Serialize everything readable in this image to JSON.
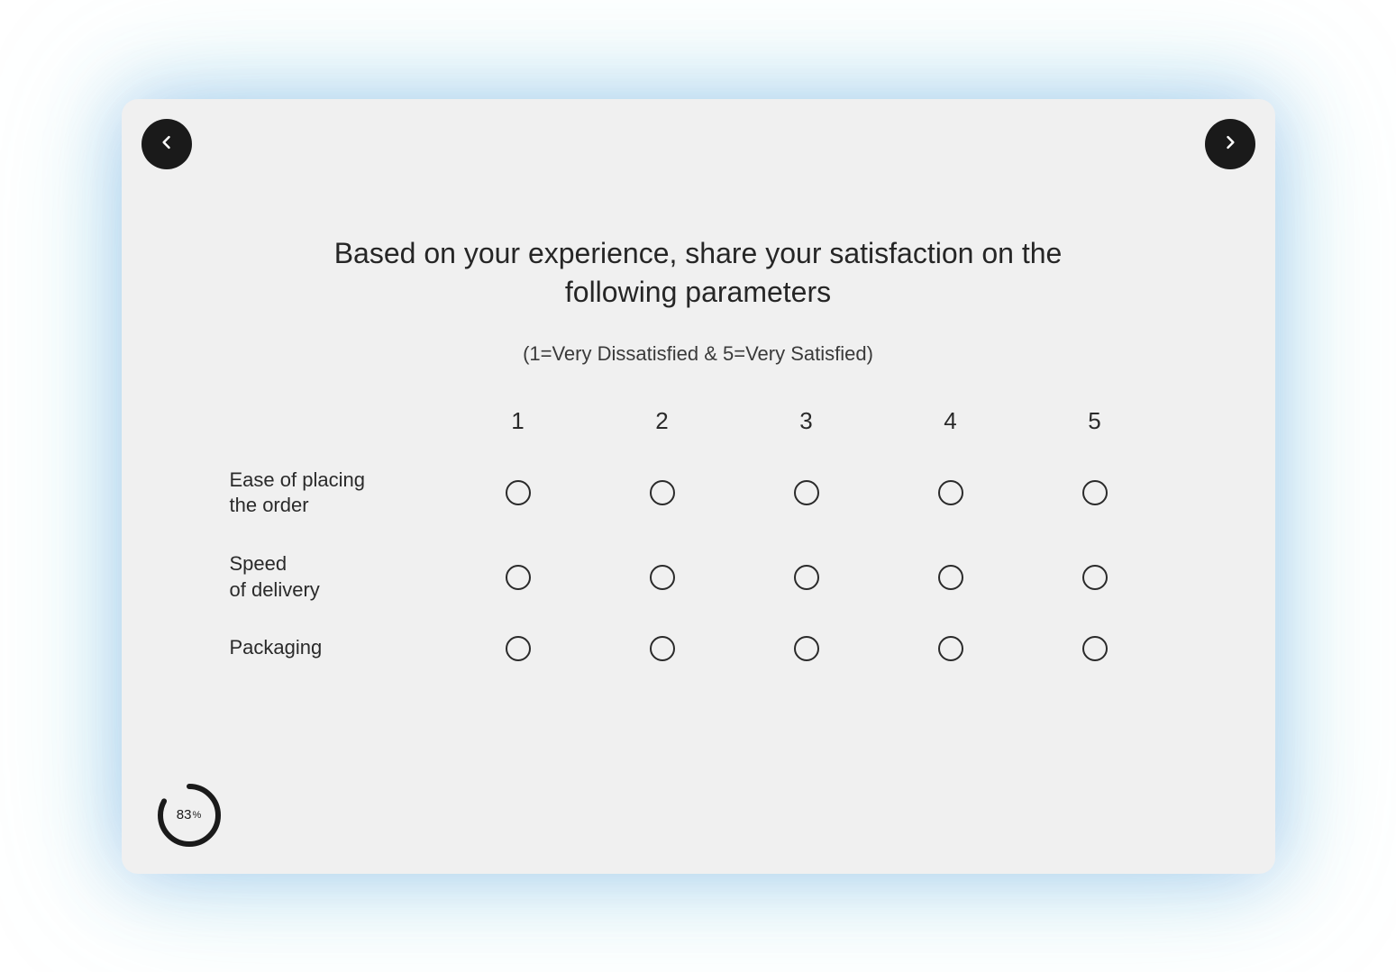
{
  "question": {
    "title": "Based on your experience, share your satisfaction on the following parameters",
    "subtitle": "(1=Very Dissatisfied & 5=Very Satisfied)"
  },
  "scale": {
    "columns": [
      "1",
      "2",
      "3",
      "4",
      "5"
    ]
  },
  "rows": [
    {
      "label": "Ease of placing\nthe order"
    },
    {
      "label": "Speed\nof delivery"
    },
    {
      "label": "Packaging"
    }
  ],
  "progress": {
    "value": 83,
    "display": "83",
    "unit": "%"
  },
  "nav": {
    "prev_aria": "Previous",
    "next_aria": "Next"
  }
}
